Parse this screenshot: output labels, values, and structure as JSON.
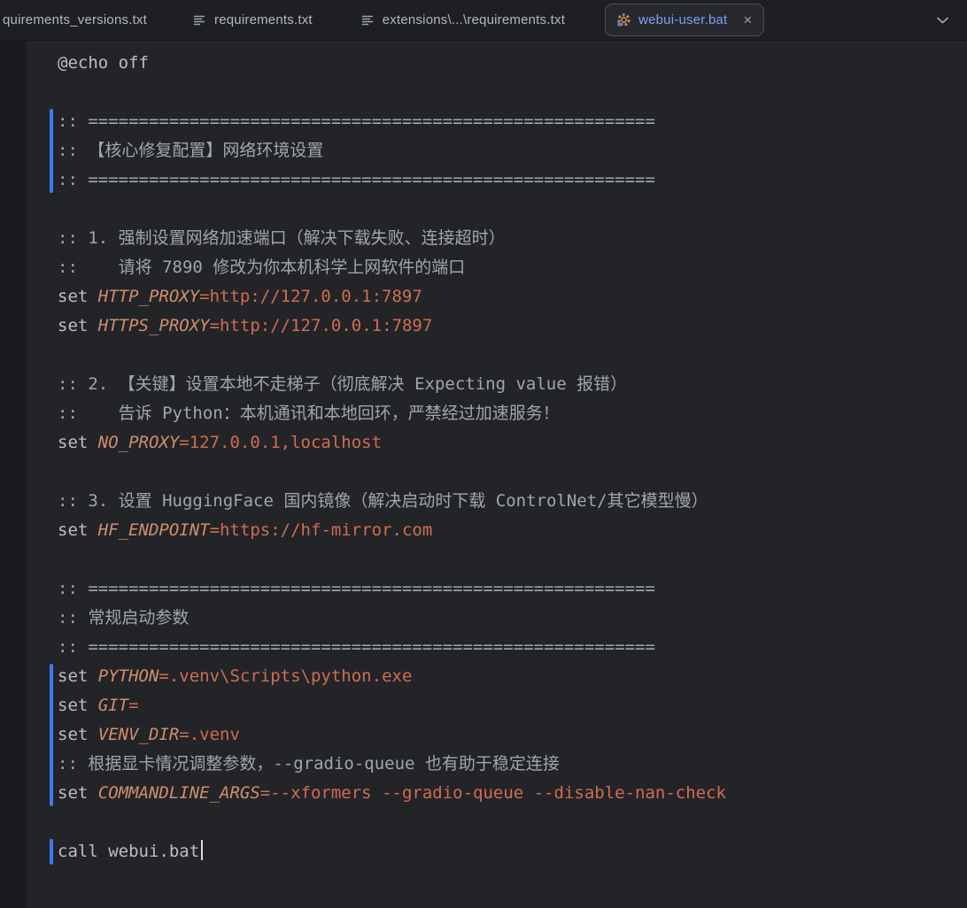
{
  "tabs": {
    "items": [
      {
        "label": "quirements_versions.txt",
        "icon": "text-file",
        "active": false
      },
      {
        "label": "requirements.txt",
        "icon": "text-file",
        "active": false
      },
      {
        "label": "extensions\\...\\requirements.txt",
        "icon": "text-file",
        "active": false
      },
      {
        "label": "webui-user.bat",
        "icon": "bat-gear",
        "active": true
      }
    ],
    "close_glyph": "×",
    "overflow_icon": "chevron-down"
  },
  "colors": {
    "accent": "#3d7bf0",
    "keyword": "#bcbec4",
    "comment": "#a0a6ae",
    "variable": "#cf8e6d",
    "value": "#cf6d51",
    "active_tab_text": "#7ba2f6"
  },
  "editor": {
    "language": "batch",
    "lines": [
      {
        "tokens": [
          {
            "t": "@echo off",
            "s": "p"
          }
        ]
      },
      {
        "tokens": []
      },
      {
        "tokens": [
          {
            "t": ":: ========================================================",
            "s": "c"
          }
        ]
      },
      {
        "tokens": [
          {
            "t": ":: 【核心修复配置】网络环境设置",
            "s": "c"
          }
        ]
      },
      {
        "tokens": [
          {
            "t": ":: ========================================================",
            "s": "c"
          }
        ]
      },
      {
        "tokens": []
      },
      {
        "tokens": [
          {
            "t": ":: 1. 强制设置网络加速端口（解决下载失败、连接超时）",
            "s": "c"
          }
        ]
      },
      {
        "tokens": [
          {
            "t": "::    请将 7890 修改为你本机科学上网软件的端口",
            "s": "c"
          }
        ]
      },
      {
        "tokens": [
          {
            "t": "set ",
            "s": "p"
          },
          {
            "t": "HTTP_PROXY",
            "s": "v"
          },
          {
            "t": "=http://127.0.0.1:7897",
            "s": "s"
          }
        ]
      },
      {
        "tokens": [
          {
            "t": "set ",
            "s": "p"
          },
          {
            "t": "HTTPS_PROXY",
            "s": "v"
          },
          {
            "t": "=http://127.0.0.1:7897",
            "s": "s"
          }
        ]
      },
      {
        "tokens": []
      },
      {
        "tokens": [
          {
            "t": ":: 2. 【关键】设置本地不走梯子（彻底解决 Expecting value 报错）",
            "s": "c"
          }
        ]
      },
      {
        "tokens": [
          {
            "t": "::    告诉 Python：本机通讯和本地回环，严禁经过加速服务！",
            "s": "c"
          }
        ]
      },
      {
        "tokens": [
          {
            "t": "set ",
            "s": "p"
          },
          {
            "t": "NO_PROXY",
            "s": "v"
          },
          {
            "t": "=127.0.0.1,localhost",
            "s": "s"
          }
        ]
      },
      {
        "tokens": []
      },
      {
        "tokens": [
          {
            "t": ":: 3. 设置 HuggingFace 国内镜像（解决启动时下载 ControlNet/其它模型慢）",
            "s": "c"
          }
        ]
      },
      {
        "tokens": [
          {
            "t": "set ",
            "s": "p"
          },
          {
            "t": "HF_ENDPOINT",
            "s": "v"
          },
          {
            "t": "=https://hf-mirror.com",
            "s": "s"
          }
        ]
      },
      {
        "tokens": []
      },
      {
        "tokens": [
          {
            "t": ":: ========================================================",
            "s": "c"
          }
        ]
      },
      {
        "tokens": [
          {
            "t": ":: 常规启动参数",
            "s": "c"
          }
        ]
      },
      {
        "tokens": [
          {
            "t": ":: ========================================================",
            "s": "c"
          }
        ]
      },
      {
        "tokens": [
          {
            "t": "set ",
            "s": "p"
          },
          {
            "t": "PYTHON",
            "s": "v"
          },
          {
            "t": "=.venv\\Scripts\\python.exe",
            "s": "s"
          }
        ]
      },
      {
        "tokens": [
          {
            "t": "set ",
            "s": "p"
          },
          {
            "t": "GIT",
            "s": "v"
          },
          {
            "t": "=",
            "s": "s"
          }
        ]
      },
      {
        "tokens": [
          {
            "t": "set ",
            "s": "p"
          },
          {
            "t": "VENV_DIR",
            "s": "v"
          },
          {
            "t": "=.venv",
            "s": "s"
          }
        ]
      },
      {
        "tokens": [
          {
            "t": ":: 根据显卡情况调整参数，--gradio-queue 也有助于稳定连接",
            "s": "c"
          }
        ]
      },
      {
        "tokens": [
          {
            "t": "set ",
            "s": "p"
          },
          {
            "t": "COMMANDLINE_ARGS",
            "s": "v"
          },
          {
            "t": "=--xformers --gradio-queue --disable-nan-check",
            "s": "s"
          }
        ]
      },
      {
        "tokens": []
      },
      {
        "tokens": [
          {
            "t": "call webui.bat",
            "s": "p"
          }
        ],
        "caret": true
      }
    ],
    "change_bars": [
      {
        "from": 2,
        "count": 3
      },
      {
        "from": 21,
        "count": 5
      },
      {
        "from": 27,
        "count": 1
      }
    ]
  }
}
